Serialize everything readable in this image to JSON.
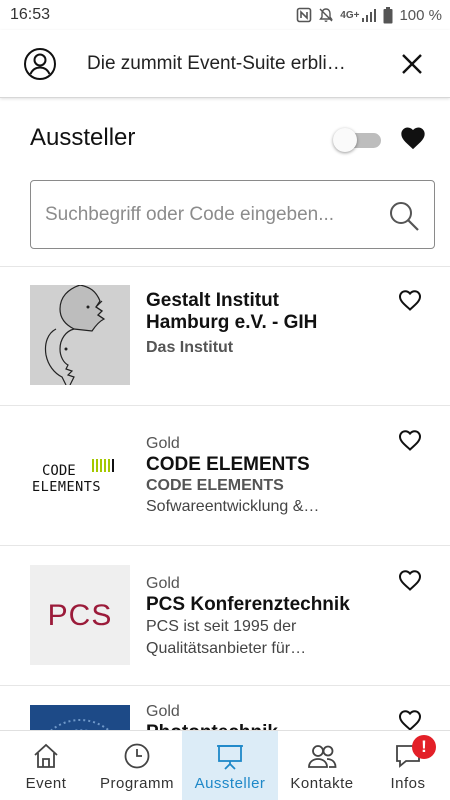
{
  "status_bar": {
    "time": "16:53",
    "battery": "100 %",
    "network": "4G+"
  },
  "banner": {
    "text": "Die zummit Event-Suite erbli…",
    "icons": [
      "user-circle-icon",
      "close-icon"
    ]
  },
  "header": {
    "title": "Aussteller",
    "favorites_toggle": false
  },
  "search": {
    "placeholder": "Suchbegriff oder Code eingeben..."
  },
  "exhibitors": [
    {
      "level": "",
      "name": "Gestalt Institut Hamburg e.V. - GIH",
      "subtitle": "Das Institut",
      "description": "",
      "logo": "gestalt-faces-logo"
    },
    {
      "level": "Gold",
      "name": "CODE ELEMENTS",
      "subtitle": "CODE ELEMENTS",
      "description": "Sofwareentwicklung &…",
      "logo": {
        "line1": "CODE",
        "line2": "ELEMENTS",
        "accent": "#a5c800"
      }
    },
    {
      "level": "Gold",
      "name": "PCS Konferenztechnik",
      "subtitle": "",
      "description": "PCS ist seit 1995 der Qualitätsanbieter für…",
      "logo": {
        "text": "PCS",
        "color": "#9b1b3a"
      }
    },
    {
      "level": "Gold",
      "name": "Photontechnik…",
      "subtitle": "",
      "description": "",
      "logo": "blue-radial-logo"
    }
  ],
  "bottom_nav": [
    {
      "label": "Event",
      "icon": "home-icon",
      "active": false
    },
    {
      "label": "Programm",
      "icon": "clock-icon",
      "active": false
    },
    {
      "label": "Aussteller",
      "icon": "presentation-icon",
      "active": true
    },
    {
      "label": "Kontakte",
      "icon": "contacts-icon",
      "active": false
    },
    {
      "label": "Infos",
      "icon": "chat-icon",
      "active": false,
      "badge": "!"
    }
  ],
  "colors": {
    "accent": "#1e88c8",
    "active_tab_bg": "#dcecf7",
    "badge": "#e32028"
  }
}
